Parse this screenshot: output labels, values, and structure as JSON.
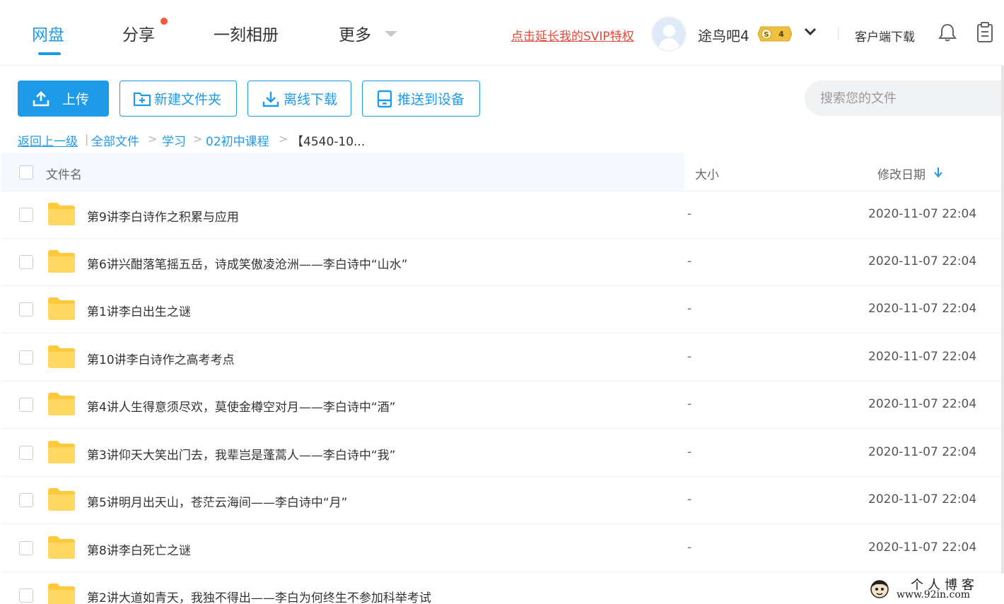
{
  "nav": {
    "items": [
      {
        "label": "网盘",
        "active": true
      },
      {
        "label": "分享",
        "has_dot": true
      },
      {
        "label": "一刻相册"
      },
      {
        "label": "更多"
      }
    ],
    "svip_link": "点击延长我的SVIP特权",
    "username": "途鸟吧4",
    "vip_badge": {
      "symbol": "S",
      "level": "4"
    },
    "client_download": "客户端下载",
    "icons": [
      "bell-icon",
      "clipboard-icon",
      "chevron-down-icon"
    ]
  },
  "toolbar": {
    "upload": "上传",
    "new_folder": "新建文件夹",
    "offline_download": "离线下载",
    "push_device": "推送到设备",
    "search_placeholder": "搜索您的文件"
  },
  "breadcrumb": {
    "back": "返回上一级",
    "items": [
      "全部文件",
      "学习",
      "02初中课程"
    ],
    "current": "【4540-10..."
  },
  "table": {
    "columns": {
      "name": "文件名",
      "size": "大小",
      "date": "修改日期"
    },
    "sort": {
      "column": "date",
      "direction": "down"
    },
    "rows": [
      {
        "name": "第9讲李白诗作之积累与应用",
        "size": "-",
        "date": "2020-11-07 22:04"
      },
      {
        "name": "第6讲兴酣落笔摇五岳，诗成笑傲凌沧洲——李白诗中“山水”",
        "size": "-",
        "date": "2020-11-07 22:04"
      },
      {
        "name": "第1讲李白出生之谜",
        "size": "-",
        "date": "2020-11-07 22:04"
      },
      {
        "name": "第10讲李白诗作之高考考点",
        "size": "-",
        "date": "2020-11-07 22:04"
      },
      {
        "name": "第4讲人生得意须尽欢，莫使金樽空对月——李白诗中“酒”",
        "size": "-",
        "date": "2020-11-07 22:04"
      },
      {
        "name": "第3讲仰天大笑出门去，我辈岂是蓬蒿人——李白诗中“我”",
        "size": "-",
        "date": "2020-11-07 22:04"
      },
      {
        "name": "第5讲明月出天山，苍茫云海间——李白诗中“月”",
        "size": "-",
        "date": "2020-11-07 22:04"
      },
      {
        "name": "第8讲李白死亡之谜",
        "size": "-",
        "date": "2020-11-07 22:04"
      },
      {
        "name": "第2讲大道如青天，我独不得出——李白为何终生不参加科举考试",
        "size": "",
        "date": ""
      }
    ]
  },
  "watermark": {
    "title": "个人博客",
    "url": "www.92in.com"
  },
  "colors": {
    "accent": "#1e9be8",
    "svip": "#e04a3a",
    "folder": "#ffd35a",
    "header_bg": "#f5f9fe"
  }
}
